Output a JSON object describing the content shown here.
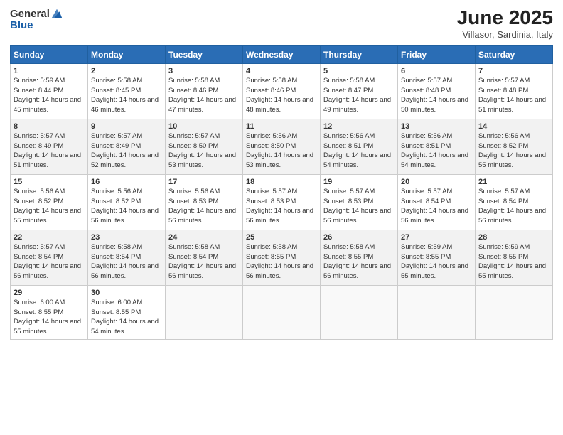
{
  "header": {
    "logo_general": "General",
    "logo_blue": "Blue",
    "title": "June 2025",
    "location": "Villasor, Sardinia, Italy"
  },
  "weekdays": [
    "Sunday",
    "Monday",
    "Tuesday",
    "Wednesday",
    "Thursday",
    "Friday",
    "Saturday"
  ],
  "weeks": [
    [
      {
        "day": "1",
        "sunrise": "5:59 AM",
        "sunset": "8:44 PM",
        "daylight": "14 hours and 45 minutes."
      },
      {
        "day": "2",
        "sunrise": "5:58 AM",
        "sunset": "8:45 PM",
        "daylight": "14 hours and 46 minutes."
      },
      {
        "day": "3",
        "sunrise": "5:58 AM",
        "sunset": "8:46 PM",
        "daylight": "14 hours and 47 minutes."
      },
      {
        "day": "4",
        "sunrise": "5:58 AM",
        "sunset": "8:46 PM",
        "daylight": "14 hours and 48 minutes."
      },
      {
        "day": "5",
        "sunrise": "5:58 AM",
        "sunset": "8:47 PM",
        "daylight": "14 hours and 49 minutes."
      },
      {
        "day": "6",
        "sunrise": "5:57 AM",
        "sunset": "8:48 PM",
        "daylight": "14 hours and 50 minutes."
      },
      {
        "day": "7",
        "sunrise": "5:57 AM",
        "sunset": "8:48 PM",
        "daylight": "14 hours and 51 minutes."
      }
    ],
    [
      {
        "day": "8",
        "sunrise": "5:57 AM",
        "sunset": "8:49 PM",
        "daylight": "14 hours and 51 minutes."
      },
      {
        "day": "9",
        "sunrise": "5:57 AM",
        "sunset": "8:49 PM",
        "daylight": "14 hours and 52 minutes."
      },
      {
        "day": "10",
        "sunrise": "5:57 AM",
        "sunset": "8:50 PM",
        "daylight": "14 hours and 53 minutes."
      },
      {
        "day": "11",
        "sunrise": "5:56 AM",
        "sunset": "8:50 PM",
        "daylight": "14 hours and 53 minutes."
      },
      {
        "day": "12",
        "sunrise": "5:56 AM",
        "sunset": "8:51 PM",
        "daylight": "14 hours and 54 minutes."
      },
      {
        "day": "13",
        "sunrise": "5:56 AM",
        "sunset": "8:51 PM",
        "daylight": "14 hours and 54 minutes."
      },
      {
        "day": "14",
        "sunrise": "5:56 AM",
        "sunset": "8:52 PM",
        "daylight": "14 hours and 55 minutes."
      }
    ],
    [
      {
        "day": "15",
        "sunrise": "5:56 AM",
        "sunset": "8:52 PM",
        "daylight": "14 hours and 55 minutes."
      },
      {
        "day": "16",
        "sunrise": "5:56 AM",
        "sunset": "8:52 PM",
        "daylight": "14 hours and 56 minutes."
      },
      {
        "day": "17",
        "sunrise": "5:56 AM",
        "sunset": "8:53 PM",
        "daylight": "14 hours and 56 minutes."
      },
      {
        "day": "18",
        "sunrise": "5:57 AM",
        "sunset": "8:53 PM",
        "daylight": "14 hours and 56 minutes."
      },
      {
        "day": "19",
        "sunrise": "5:57 AM",
        "sunset": "8:53 PM",
        "daylight": "14 hours and 56 minutes."
      },
      {
        "day": "20",
        "sunrise": "5:57 AM",
        "sunset": "8:54 PM",
        "daylight": "14 hours and 56 minutes."
      },
      {
        "day": "21",
        "sunrise": "5:57 AM",
        "sunset": "8:54 PM",
        "daylight": "14 hours and 56 minutes."
      }
    ],
    [
      {
        "day": "22",
        "sunrise": "5:57 AM",
        "sunset": "8:54 PM",
        "daylight": "14 hours and 56 minutes."
      },
      {
        "day": "23",
        "sunrise": "5:58 AM",
        "sunset": "8:54 PM",
        "daylight": "14 hours and 56 minutes."
      },
      {
        "day": "24",
        "sunrise": "5:58 AM",
        "sunset": "8:54 PM",
        "daylight": "14 hours and 56 minutes."
      },
      {
        "day": "25",
        "sunrise": "5:58 AM",
        "sunset": "8:55 PM",
        "daylight": "14 hours and 56 minutes."
      },
      {
        "day": "26",
        "sunrise": "5:58 AM",
        "sunset": "8:55 PM",
        "daylight": "14 hours and 56 minutes."
      },
      {
        "day": "27",
        "sunrise": "5:59 AM",
        "sunset": "8:55 PM",
        "daylight": "14 hours and 55 minutes."
      },
      {
        "day": "28",
        "sunrise": "5:59 AM",
        "sunset": "8:55 PM",
        "daylight": "14 hours and 55 minutes."
      }
    ],
    [
      {
        "day": "29",
        "sunrise": "6:00 AM",
        "sunset": "8:55 PM",
        "daylight": "14 hours and 55 minutes."
      },
      {
        "day": "30",
        "sunrise": "6:00 AM",
        "sunset": "8:55 PM",
        "daylight": "14 hours and 54 minutes."
      },
      {
        "day": "",
        "sunrise": "",
        "sunset": "",
        "daylight": ""
      },
      {
        "day": "",
        "sunrise": "",
        "sunset": "",
        "daylight": ""
      },
      {
        "day": "",
        "sunrise": "",
        "sunset": "",
        "daylight": ""
      },
      {
        "day": "",
        "sunrise": "",
        "sunset": "",
        "daylight": ""
      },
      {
        "day": "",
        "sunrise": "",
        "sunset": "",
        "daylight": ""
      }
    ]
  ]
}
